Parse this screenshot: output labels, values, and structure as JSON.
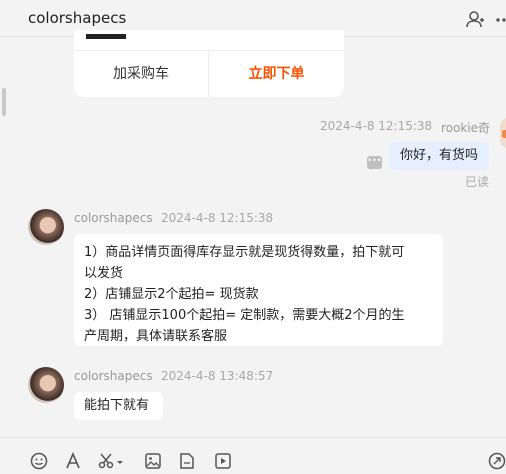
{
  "header": {
    "title": "colorshapecs"
  },
  "product_card": {
    "add_to_cart_label": "加采购车",
    "buy_now_label": "立即下单",
    "buy_now_color": "#ff5000"
  },
  "messages": [
    {
      "side": "right",
      "sender": "rookie奇",
      "time": "2024-4-8 12:15:38",
      "text": "你好，有货吗",
      "status": "已读"
    },
    {
      "side": "left",
      "sender": "colorshapecs",
      "time": "2024-4-8 12:15:38",
      "lines": [
        "1）商品详情页面得库存显示就是现货得数量，拍下就可",
        "以发货",
        "2）店铺显示2个起拍= 现货款",
        "3）  店铺显示100个起拍=    定制款，需要大概2个月的生",
        "产周期，具体请联系客服"
      ]
    },
    {
      "side": "left",
      "sender": "colorshapecs",
      "time": "2024-4-8 13:48:57",
      "text": "能拍下就有"
    }
  ],
  "toolbar": {
    "icons": [
      "emoji-icon",
      "font-icon",
      "scissors-icon",
      "image-icon",
      "file-icon",
      "video-icon",
      "send-icon"
    ]
  }
}
